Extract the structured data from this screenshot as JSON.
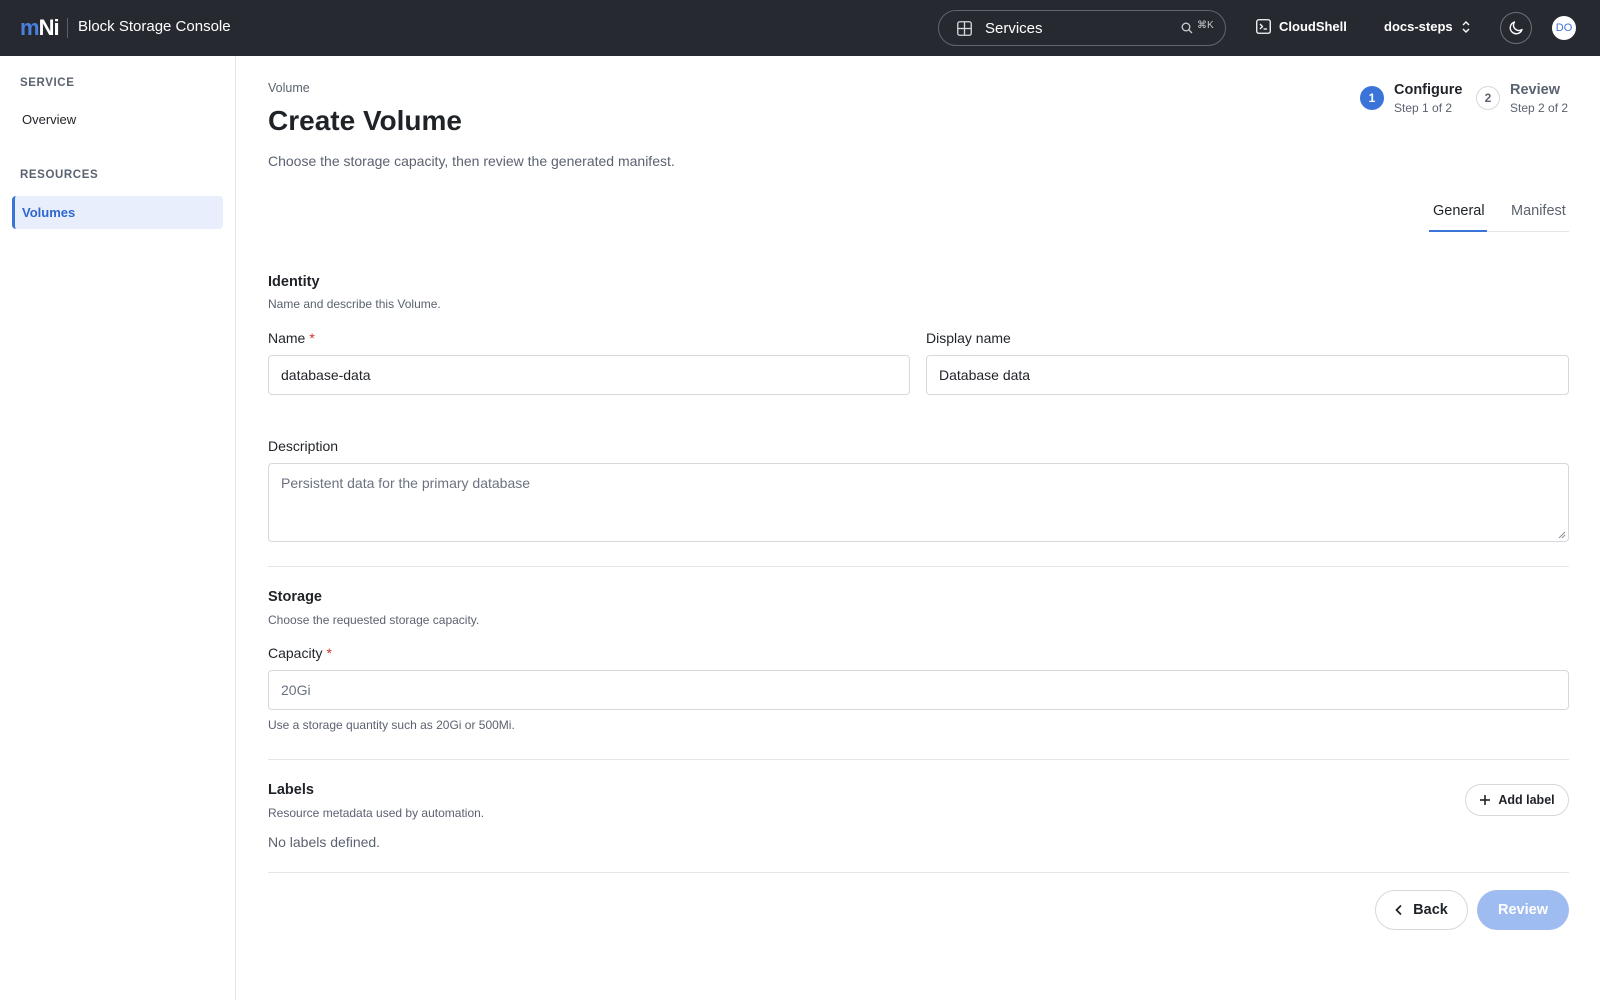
{
  "header": {
    "logo_m": "m",
    "logo_ni": "Ni",
    "app_title": "Block Storage Console",
    "search_label": "Services",
    "search_shortcut": "⌘K",
    "cloudshell_label": "CloudShell",
    "project_label": "docs-steps",
    "avatar_initials": "DO",
    "icons": [
      "grid-icon",
      "search-icon",
      "terminal-icon",
      "chevron-updown-icon",
      "moon-icon"
    ]
  },
  "sidebar": {
    "sections": [
      {
        "title": "SERVICE",
        "items": [
          {
            "label": "Overview",
            "active": false
          }
        ]
      },
      {
        "title": "RESOURCES",
        "items": [
          {
            "label": "Volumes",
            "active": true
          }
        ]
      }
    ]
  },
  "page": {
    "breadcrumb": "Volume",
    "title": "Create Volume",
    "subtitle": "Choose the storage capacity, then review the generated manifest."
  },
  "stepper": [
    {
      "number": "1",
      "title": "Configure",
      "sub": "Step 1 of 2",
      "active": true
    },
    {
      "number": "2",
      "title": "Review",
      "sub": "Step 2 of 2",
      "active": false
    }
  ],
  "tabs": [
    {
      "label": "General",
      "active": true
    },
    {
      "label": "Manifest",
      "active": false
    }
  ],
  "identity": {
    "title": "Identity",
    "subtitle": "Name and describe this Volume.",
    "name_label": "Name",
    "name_value": "database-data",
    "display_name_label": "Display name",
    "display_name_value": "Database data",
    "description_label": "Description",
    "description_placeholder": "Persistent data for the primary database"
  },
  "storage": {
    "title": "Storage",
    "subtitle": "Choose the requested storage capacity.",
    "capacity_label": "Capacity",
    "capacity_placeholder": "20Gi",
    "capacity_hint": "Use a storage quantity such as 20Gi or 500Mi."
  },
  "labels": {
    "title": "Labels",
    "subtitle": "Resource metadata used by automation.",
    "add_button": "Add label",
    "empty_text": "No labels defined."
  },
  "footer": {
    "back_label": "Back",
    "review_label": "Review"
  },
  "colors": {
    "topbar": "#262a30",
    "accent": "#3a74d8",
    "review_disabled": "#9fbcf0",
    "required": "#d0342c"
  }
}
